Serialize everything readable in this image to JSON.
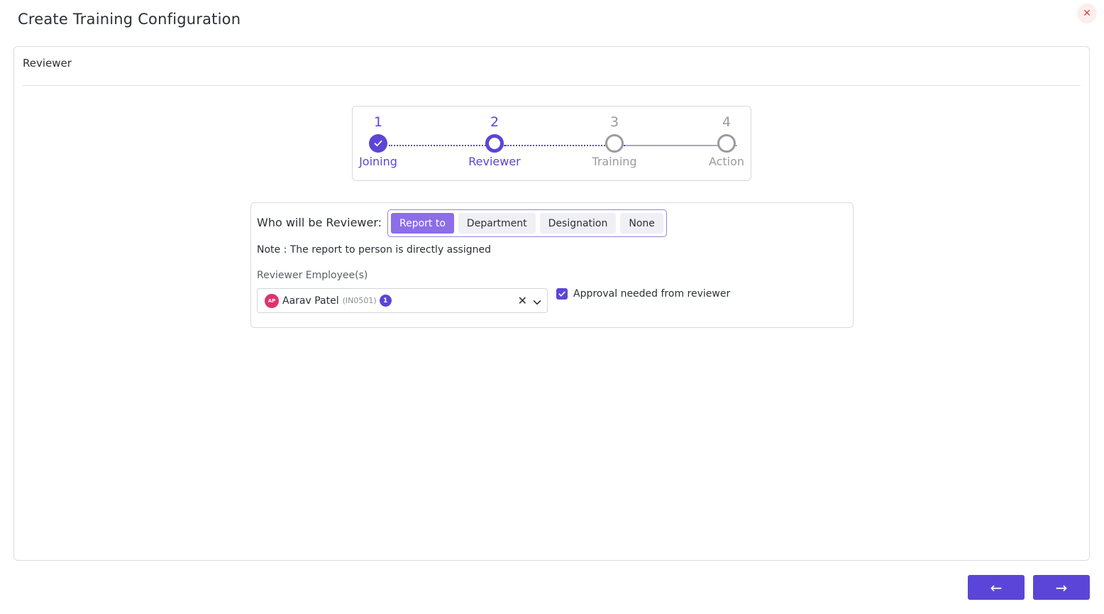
{
  "modal": {
    "title": "Create Training Configuration",
    "close_glyph": "✕"
  },
  "panel": {
    "header": "Reviewer"
  },
  "stepper": {
    "steps": [
      {
        "number": "1",
        "label": "Joining",
        "state": "done"
      },
      {
        "number": "2",
        "label": "Reviewer",
        "state": "active"
      },
      {
        "number": "3",
        "label": "Training",
        "state": "pending"
      },
      {
        "number": "4",
        "label": "Action",
        "state": "pending"
      }
    ]
  },
  "reviewer": {
    "question": "Who will be Reviewer:",
    "options": [
      "Report to",
      "Department",
      "Designation",
      "None"
    ],
    "selected": "Report to",
    "note": "Note : The report to person is directly assigned",
    "employees_label": "Reviewer Employee(s)",
    "selected_employee": {
      "initials": "AP",
      "name": "Aarav Patel",
      "code": "(IN0501)",
      "count": "1"
    },
    "clear_glyph": "✕",
    "approval_label": "Approval needed from reviewer",
    "approval_checked": true
  },
  "footer": {
    "back_glyph": "←",
    "next_glyph": "→"
  },
  "colors": {
    "accent": "#5b45d8",
    "selected_option": "#8c6ee9",
    "avatar": "#e0326d",
    "close": "#e2433b"
  }
}
